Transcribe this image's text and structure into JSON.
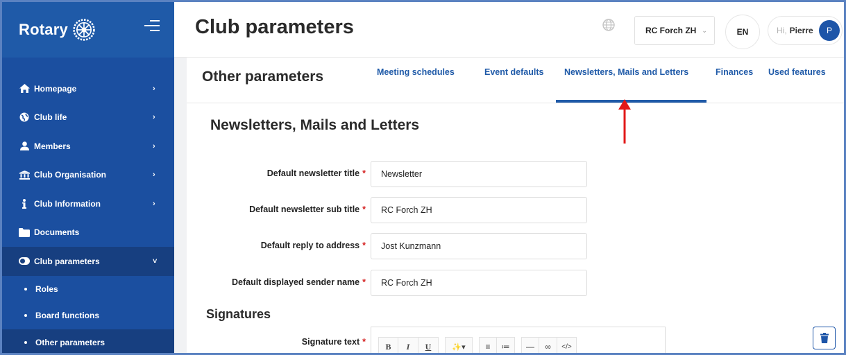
{
  "sidebar": {
    "brand": "Rotary",
    "items": [
      {
        "label": "Homepage",
        "icon": "home-icon",
        "chevron": "›"
      },
      {
        "label": "Club life",
        "icon": "globe-icon",
        "chevron": "›"
      },
      {
        "label": "Members",
        "icon": "user-icon",
        "chevron": "›"
      },
      {
        "label": "Club Organisation",
        "icon": "institution-icon",
        "chevron": "›"
      },
      {
        "label": "Club Information",
        "icon": "info-icon",
        "chevron": "›"
      },
      {
        "label": "Documents",
        "icon": "folder-icon",
        "chevron": ""
      },
      {
        "label": "Club parameters",
        "icon": "toggle-icon",
        "chevron": "˅"
      }
    ],
    "sub_items": [
      {
        "label": "Roles"
      },
      {
        "label": "Board functions"
      },
      {
        "label": "Other parameters"
      }
    ]
  },
  "header": {
    "title": "Club parameters",
    "club": "RC Forch ZH",
    "language": "EN",
    "greeting": "Hi,",
    "user": "Pierre",
    "avatar_initial": "P"
  },
  "section": {
    "title": "Other parameters",
    "tabs": [
      {
        "label": "Meeting schedules"
      },
      {
        "label": "Event defaults"
      },
      {
        "label": "Newsletters, Mails and Letters"
      },
      {
        "label": "Finances"
      },
      {
        "label": "Used features"
      }
    ],
    "active_tab": "Newsletters, Mails and Letters"
  },
  "form": {
    "title": "Newsletters, Mails and Letters",
    "required_mark": "*",
    "fields": [
      {
        "label": "Default newsletter title",
        "value": "Newsletter"
      },
      {
        "label": "Default newsletter sub title",
        "value": "RC Forch ZH"
      },
      {
        "label": "Default reply to address",
        "value": "Jost Kunzmann"
      },
      {
        "label": "Default displayed sender name",
        "value": "RC Forch ZH"
      }
    ],
    "signatures_title": "Signatures",
    "signature_label": "Signature text",
    "toolbar": {
      "bold": "B",
      "italic": "I",
      "underline": "U",
      "magic": "✨▾",
      "bullet_list": "≡",
      "numbered_list": "≔",
      "hr": "—",
      "link": "∞",
      "code": "</>"
    }
  },
  "colors": {
    "sidebar": "#1b4fa0",
    "accent": "#1f5aa8",
    "required": "#d42020",
    "annotation_arrow": "#e21818"
  }
}
